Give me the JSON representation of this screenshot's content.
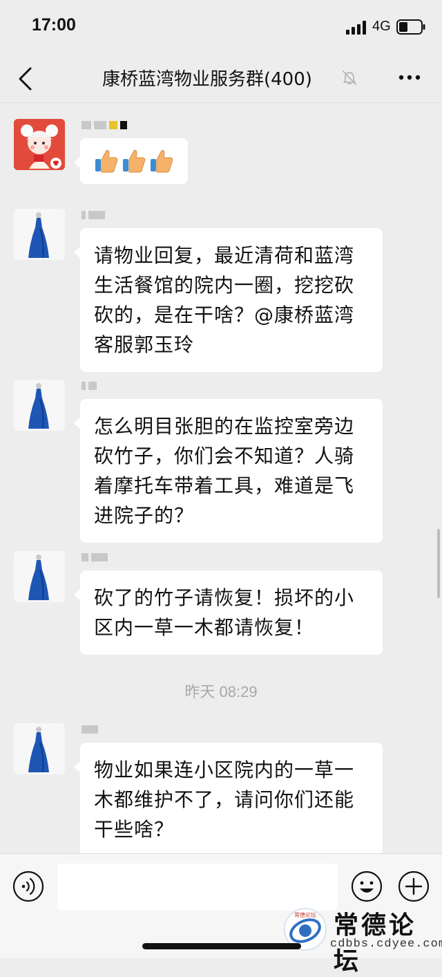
{
  "status_bar": {
    "time": "17:00",
    "network": "4G"
  },
  "nav": {
    "title": "康桥蓝湾物业服务群(400)"
  },
  "messages": [
    {
      "type": "emoji",
      "emoji": [
        "👍",
        "👍",
        "👍"
      ]
    },
    {
      "type": "text",
      "text": "请物业回复，最近清荷和蓝湾生活餐馆的院内一圈，挖挖砍砍的，是在干啥？@康桥蓝湾客服郭玉玲"
    },
    {
      "type": "text",
      "text": "怎么明目张胆的在监控室旁边砍竹子，你们会不知道？人骑着摩托车带着工具，难道是飞进院子的？"
    },
    {
      "type": "text",
      "text": "砍了的竹子请恢复！损坏的小区内一草一木都请恢复！"
    },
    {
      "type": "text",
      "text": "物业如果连小区院内的一草一木都维护不了，请问你们还能干些啥？"
    }
  ],
  "timestamp": "昨天 08:29",
  "colors": {
    "background": "#ededed",
    "bubble": "#ffffff",
    "timestamp": "#a8a8a8",
    "avatar_dress": "#1e56b5"
  },
  "watermark": {
    "title": "常德论坛",
    "url": "cdbbs.cdyee.com",
    "logo_text": "常德论坛"
  },
  "icons": [
    "back-icon",
    "mute-bell-icon",
    "more-icon",
    "voice-icon",
    "emoji-icon",
    "plus-icon"
  ]
}
